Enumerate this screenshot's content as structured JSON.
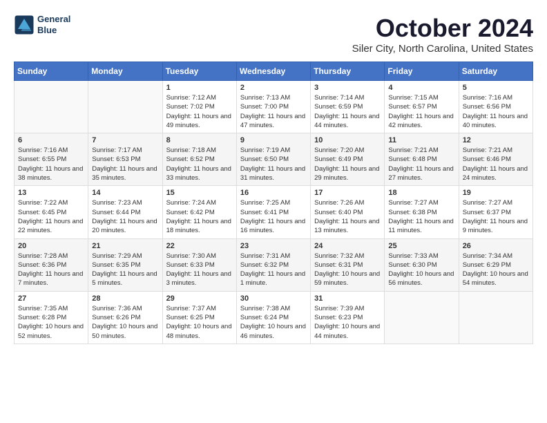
{
  "logo": {
    "line1": "General",
    "line2": "Blue"
  },
  "title": "October 2024",
  "location": "Siler City, North Carolina, United States",
  "weekdays": [
    "Sunday",
    "Monday",
    "Tuesday",
    "Wednesday",
    "Thursday",
    "Friday",
    "Saturday"
  ],
  "weeks": [
    [
      {
        "day": "",
        "content": ""
      },
      {
        "day": "",
        "content": ""
      },
      {
        "day": "1",
        "content": "Sunrise: 7:12 AM\nSunset: 7:02 PM\nDaylight: 11 hours and 49 minutes."
      },
      {
        "day": "2",
        "content": "Sunrise: 7:13 AM\nSunset: 7:00 PM\nDaylight: 11 hours and 47 minutes."
      },
      {
        "day": "3",
        "content": "Sunrise: 7:14 AM\nSunset: 6:59 PM\nDaylight: 11 hours and 44 minutes."
      },
      {
        "day": "4",
        "content": "Sunrise: 7:15 AM\nSunset: 6:57 PM\nDaylight: 11 hours and 42 minutes."
      },
      {
        "day": "5",
        "content": "Sunrise: 7:16 AM\nSunset: 6:56 PM\nDaylight: 11 hours and 40 minutes."
      }
    ],
    [
      {
        "day": "6",
        "content": "Sunrise: 7:16 AM\nSunset: 6:55 PM\nDaylight: 11 hours and 38 minutes."
      },
      {
        "day": "7",
        "content": "Sunrise: 7:17 AM\nSunset: 6:53 PM\nDaylight: 11 hours and 35 minutes."
      },
      {
        "day": "8",
        "content": "Sunrise: 7:18 AM\nSunset: 6:52 PM\nDaylight: 11 hours and 33 minutes."
      },
      {
        "day": "9",
        "content": "Sunrise: 7:19 AM\nSunset: 6:50 PM\nDaylight: 11 hours and 31 minutes."
      },
      {
        "day": "10",
        "content": "Sunrise: 7:20 AM\nSunset: 6:49 PM\nDaylight: 11 hours and 29 minutes."
      },
      {
        "day": "11",
        "content": "Sunrise: 7:21 AM\nSunset: 6:48 PM\nDaylight: 11 hours and 27 minutes."
      },
      {
        "day": "12",
        "content": "Sunrise: 7:21 AM\nSunset: 6:46 PM\nDaylight: 11 hours and 24 minutes."
      }
    ],
    [
      {
        "day": "13",
        "content": "Sunrise: 7:22 AM\nSunset: 6:45 PM\nDaylight: 11 hours and 22 minutes."
      },
      {
        "day": "14",
        "content": "Sunrise: 7:23 AM\nSunset: 6:44 PM\nDaylight: 11 hours and 20 minutes."
      },
      {
        "day": "15",
        "content": "Sunrise: 7:24 AM\nSunset: 6:42 PM\nDaylight: 11 hours and 18 minutes."
      },
      {
        "day": "16",
        "content": "Sunrise: 7:25 AM\nSunset: 6:41 PM\nDaylight: 11 hours and 16 minutes."
      },
      {
        "day": "17",
        "content": "Sunrise: 7:26 AM\nSunset: 6:40 PM\nDaylight: 11 hours and 13 minutes."
      },
      {
        "day": "18",
        "content": "Sunrise: 7:27 AM\nSunset: 6:38 PM\nDaylight: 11 hours and 11 minutes."
      },
      {
        "day": "19",
        "content": "Sunrise: 7:27 AM\nSunset: 6:37 PM\nDaylight: 11 hours and 9 minutes."
      }
    ],
    [
      {
        "day": "20",
        "content": "Sunrise: 7:28 AM\nSunset: 6:36 PM\nDaylight: 11 hours and 7 minutes."
      },
      {
        "day": "21",
        "content": "Sunrise: 7:29 AM\nSunset: 6:35 PM\nDaylight: 11 hours and 5 minutes."
      },
      {
        "day": "22",
        "content": "Sunrise: 7:30 AM\nSunset: 6:33 PM\nDaylight: 11 hours and 3 minutes."
      },
      {
        "day": "23",
        "content": "Sunrise: 7:31 AM\nSunset: 6:32 PM\nDaylight: 11 hours and 1 minute."
      },
      {
        "day": "24",
        "content": "Sunrise: 7:32 AM\nSunset: 6:31 PM\nDaylight: 10 hours and 59 minutes."
      },
      {
        "day": "25",
        "content": "Sunrise: 7:33 AM\nSunset: 6:30 PM\nDaylight: 10 hours and 56 minutes."
      },
      {
        "day": "26",
        "content": "Sunrise: 7:34 AM\nSunset: 6:29 PM\nDaylight: 10 hours and 54 minutes."
      }
    ],
    [
      {
        "day": "27",
        "content": "Sunrise: 7:35 AM\nSunset: 6:28 PM\nDaylight: 10 hours and 52 minutes."
      },
      {
        "day": "28",
        "content": "Sunrise: 7:36 AM\nSunset: 6:26 PM\nDaylight: 10 hours and 50 minutes."
      },
      {
        "day": "29",
        "content": "Sunrise: 7:37 AM\nSunset: 6:25 PM\nDaylight: 10 hours and 48 minutes."
      },
      {
        "day": "30",
        "content": "Sunrise: 7:38 AM\nSunset: 6:24 PM\nDaylight: 10 hours and 46 minutes."
      },
      {
        "day": "31",
        "content": "Sunrise: 7:39 AM\nSunset: 6:23 PM\nDaylight: 10 hours and 44 minutes."
      },
      {
        "day": "",
        "content": ""
      },
      {
        "day": "",
        "content": ""
      }
    ]
  ]
}
